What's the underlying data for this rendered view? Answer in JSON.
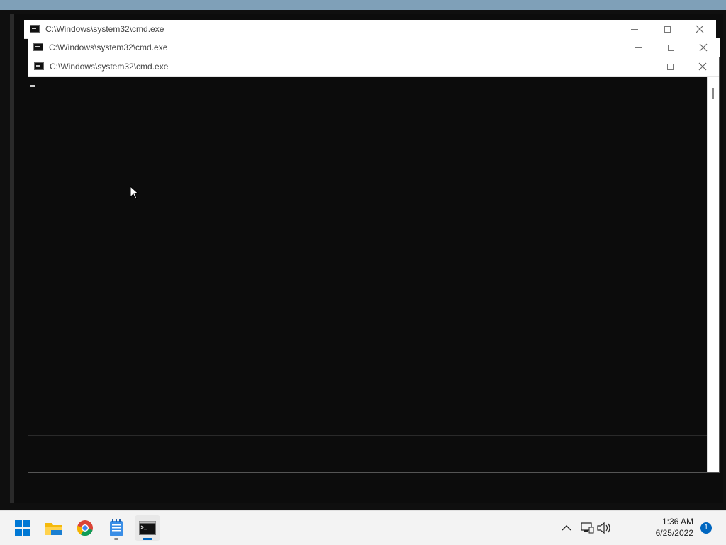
{
  "windows": [
    {
      "title": "C:\\Windows\\system32\\cmd.exe"
    },
    {
      "title": "C:\\Windows\\system32\\cmd.exe"
    },
    {
      "title": "C:\\Windows\\system32\\cmd.exe"
    }
  ],
  "taskbar": {
    "apps": [
      "start-icon",
      "file-explorer-icon",
      "chrome-icon",
      "notepad-icon",
      "command-prompt-icon"
    ],
    "time": "1:36 AM",
    "date": "6/25/2022",
    "notification_count": "1"
  },
  "colors": {
    "console_bg": "#0c0c0c",
    "accent": "#0067c0"
  }
}
